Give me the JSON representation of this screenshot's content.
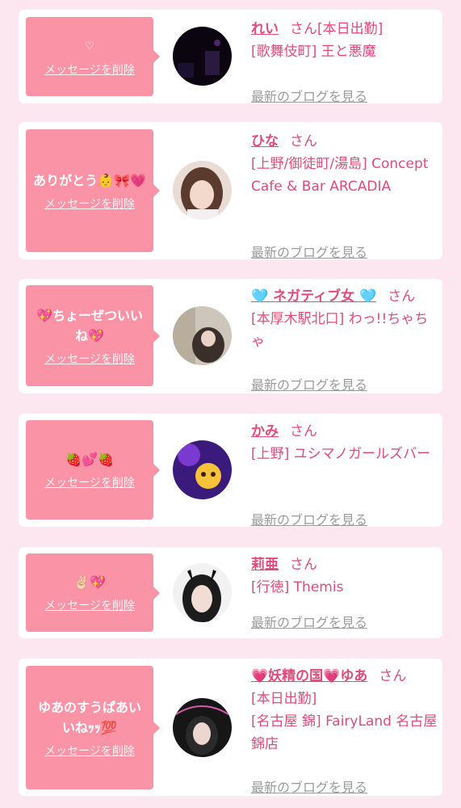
{
  "colors": {
    "accent": "#e34a7a",
    "bubble": "#fa93a6",
    "background": "#fce6ef",
    "link_gray": "#9a9a9a"
  },
  "cards": [
    {
      "message": "♡",
      "delete_label": "メッセージを削除",
      "name": "れい",
      "honorific": "さん",
      "status": "[本日出勤]",
      "shop": "[歌舞伎町] 王と悪魔",
      "blog_label": "最新のブログを見る"
    },
    {
      "message": "ありがとう👶🎀💗",
      "delete_label": "メッセージを削除",
      "name": "ひな",
      "honorific": "さん",
      "shop": "[上野/御徒町/湯島] Concept Cafe & Bar ARCADIA",
      "blog_label": "最新のブログを見る"
    },
    {
      "message": "💖ちょーぜついいね💖",
      "delete_label": "メッセージを削除",
      "name": "🩵 ネガティブ女 🩵",
      "honorific": "さん",
      "shop": "[本厚木駅北口] わっ!!ちゃちゃ",
      "blog_label": "最新のブログを見る"
    },
    {
      "message": "🍓💕🍓",
      "delete_label": "メッセージを削除",
      "name": "かみ",
      "honorific": "さん",
      "shop": "[上野] ユシマノガールズバー",
      "blog_label": "最新のブログを見る"
    },
    {
      "message": "✌🏻💖",
      "delete_label": "メッセージを削除",
      "name": "莉亜",
      "honorific": "さん",
      "shop": "[行徳] Themis",
      "blog_label": "最新のブログを見る"
    },
    {
      "message": "ゆあのすうぱあいいねｯｯ💯",
      "delete_label": "メッセージを削除",
      "name": "💗妖精の国💗ゆあ",
      "honorific": "さん",
      "status": "[本日出勤]",
      "shop": "[名古屋 錦] FairyLand 名古屋錦店",
      "blog_label": "最新のブログを見る"
    }
  ]
}
